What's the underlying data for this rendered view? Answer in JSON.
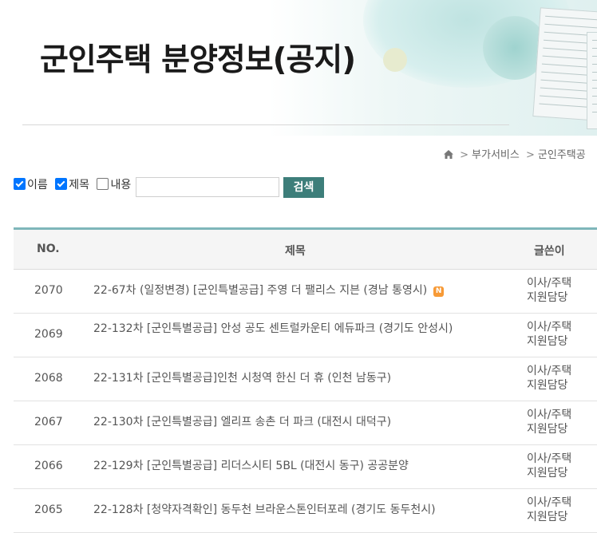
{
  "header": {
    "title": "군인주택 분양정보(공지)"
  },
  "breadcrumb": {
    "items": [
      "부가서비스",
      "군인주택공"
    ]
  },
  "search": {
    "options": [
      {
        "label": "이름",
        "checked": true
      },
      {
        "label": "제목",
        "checked": true
      },
      {
        "label": "내용",
        "checked": false
      }
    ],
    "input_value": "",
    "button_label": "검색"
  },
  "table": {
    "headers": {
      "no": "NO.",
      "subject": "제목",
      "writer": "글쓴이"
    },
    "rows": [
      {
        "no": "2070",
        "subject": "22-67차 (일정변경) [군인특별공급] 주영 더 팰리스 지븐 (경남 통영시)",
        "writer_line1": "이사/주택",
        "writer_line2": "지원담당",
        "new": true,
        "new_label": "N"
      },
      {
        "no": "2069",
        "subject": "22-132차 [군인특별공급] 안성 공도 센트럴카운티 에듀파크 (경기도 안성시)",
        "writer_line1": "이사/주택",
        "writer_line2": "지원담당"
      },
      {
        "no": "2068",
        "subject": "22-131차 [군인특별공급]인천 시청역 한신 더 휴 (인천 남동구)",
        "writer_line1": "이사/주택",
        "writer_line2": "지원담당"
      },
      {
        "no": "2067",
        "subject": "22-130차 [군인특별공급] 엘리프 송촌 더 파크 (대전시 대덕구)",
        "writer_line1": "이사/주택",
        "writer_line2": "지원담당"
      },
      {
        "no": "2066",
        "subject": "22-129차 [군인특별공급] 리더스시티 5BL (대전시 동구) 공공분양",
        "writer_line1": "이사/주택",
        "writer_line2": "지원담당"
      },
      {
        "no": "2065",
        "subject": "22-128차 [청약자격확인] 동두천 브라운스톤인터포레 (경기도 동두천시)",
        "writer_line1": "이사/주택",
        "writer_line2": "지원담당"
      }
    ]
  },
  "icons": {
    "home": "home-icon",
    "new_badge": "new-badge-icon"
  }
}
